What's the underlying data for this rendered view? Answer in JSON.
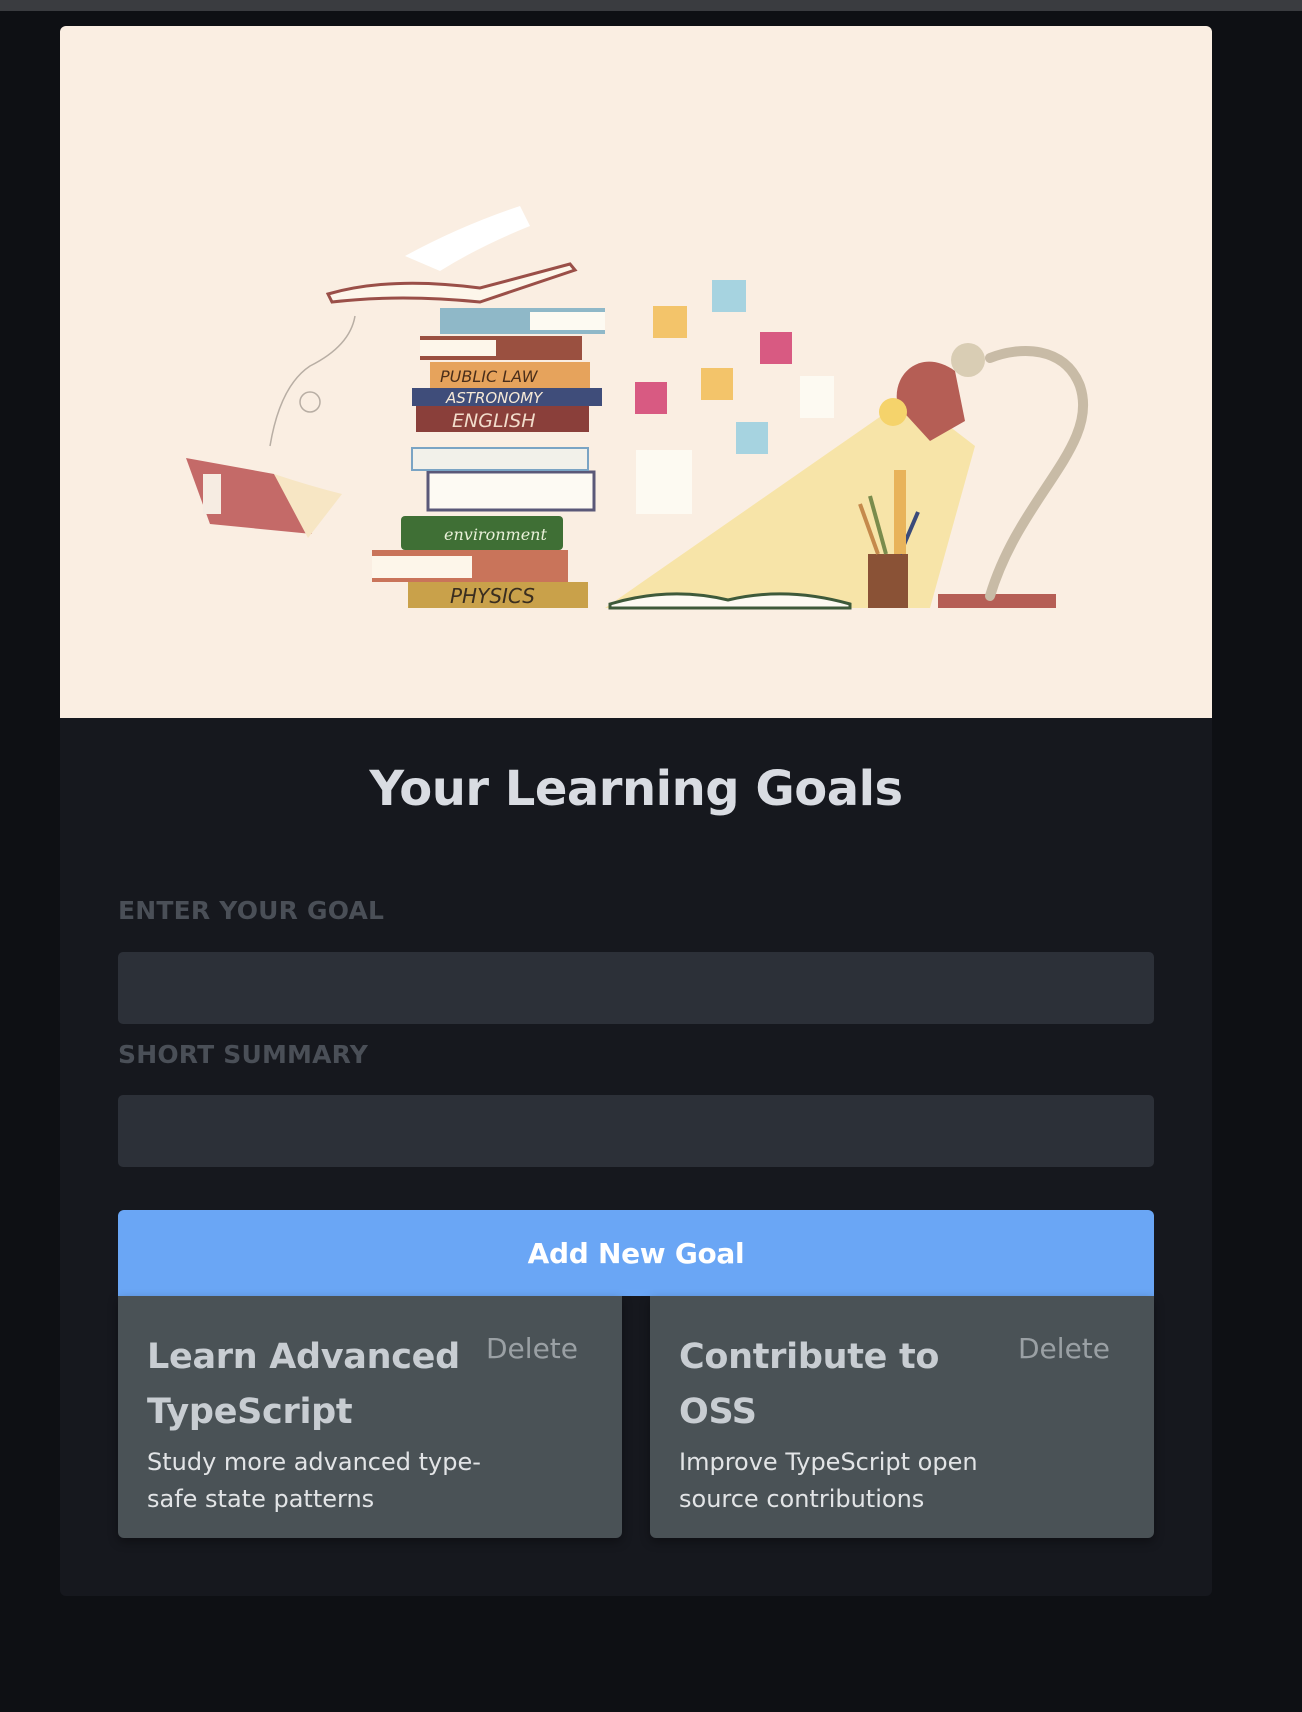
{
  "hero": {
    "book_spines": [
      "PUBLIC LAW",
      "ASTRONOMY",
      "ENGLISH",
      "environment",
      "PHYSICS"
    ],
    "colors": {
      "background": "#faeee2",
      "lamp": "#b55e55",
      "lamp_arm": "#c8bba6",
      "light_cone": "#f7e4a8"
    }
  },
  "page": {
    "title": "Your Learning Goals"
  },
  "form": {
    "goal_label": "ENTER YOUR GOAL",
    "goal_value": "",
    "goal_placeholder": "",
    "summary_label": "SHORT SUMMARY",
    "summary_value": "",
    "summary_placeholder": "",
    "submit_label": "Add New Goal"
  },
  "goals": [
    {
      "title": "Learn Advanced TypeScript",
      "summary": "Study more advanced type-safe state patterns",
      "delete_label": "Delete"
    },
    {
      "title": "Contribute to OSS",
      "summary": "Improve TypeScript open source contributions",
      "delete_label": "Delete"
    }
  ],
  "colors": {
    "page_bg": "#0e1014",
    "card_bg": "#16181e",
    "input_bg": "#2c3038",
    "accent": "#6aa6f5",
    "goal_card_bg": "#4a5256"
  }
}
